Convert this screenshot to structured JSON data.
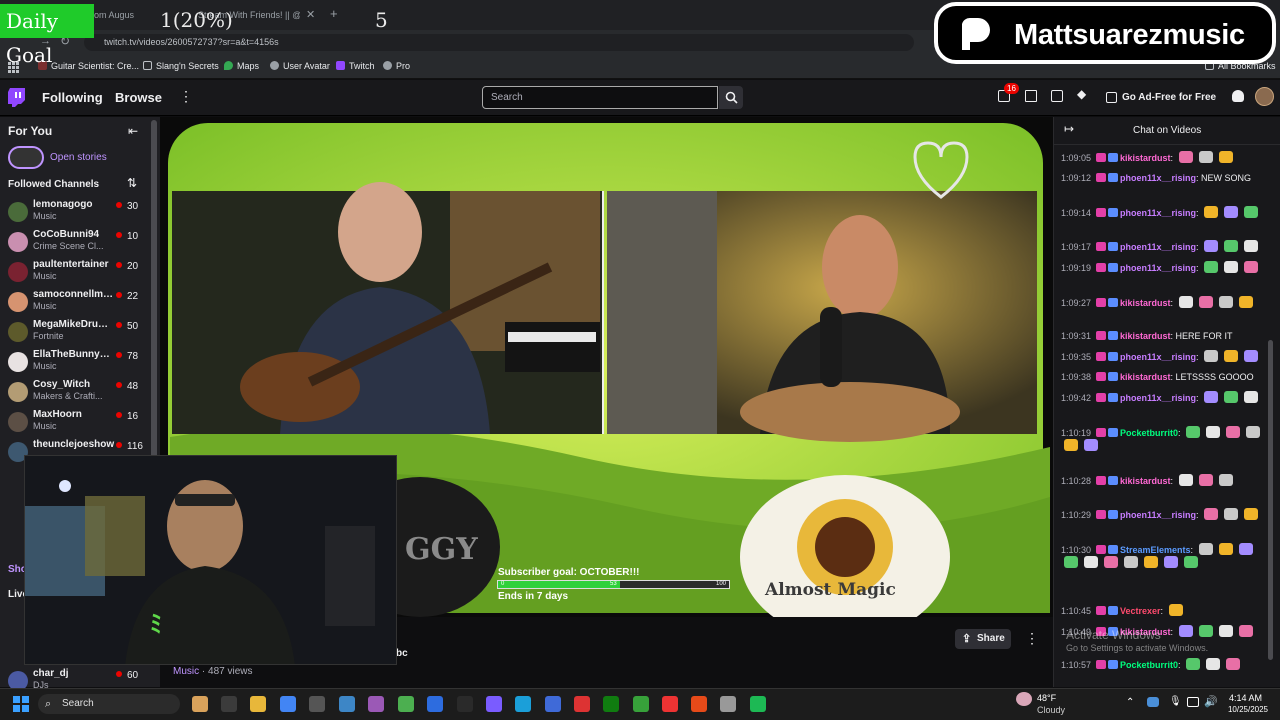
{
  "overlay": {
    "daily_goal_label": "Daily Goal",
    "goal_progress": "1(20%)",
    "goal_target": "5",
    "brand_name": "Mattsuarezmusic"
  },
  "browser": {
    "tabs": [
      {
        "label": "Live Stream from Augus"
      },
      {
        "label": "Stream With Friends! || @alm"
      }
    ],
    "url": "twitch.tv/videos/2600572737?sr=a&t=4156s",
    "bookmarks": [
      "Guitar Scientist: Cre...",
      "Slang'n Secrets",
      "Maps",
      "User Avatar",
      "Twitch",
      "Pro"
    ],
    "all_bookmarks": "All Bookmarks"
  },
  "twitch_nav": {
    "following": "Following",
    "browse": "Browse",
    "search_placeholder": "Search",
    "notifications_count": "16",
    "ad_free": "Go Ad-Free for Free"
  },
  "sidebar": {
    "for_you": "For You",
    "open_stories": "Open stories",
    "followed_channels": "Followed Channels",
    "channels": [
      {
        "name": "lemonagogo",
        "category": "Music",
        "viewers": "30",
        "color": "#4a6b3a"
      },
      {
        "name": "CoCoBunni94",
        "category": "Crime Scene Cl...",
        "viewers": "10",
        "color": "#c98fb0"
      },
      {
        "name": "paultentertainer",
        "category": "Music",
        "viewers": "20",
        "color": "#7a2231"
      },
      {
        "name": "samoconnellmu...",
        "category": "Music",
        "viewers": "22",
        "color": "#d69370"
      },
      {
        "name": "MegaMikeDrum...",
        "category": "Fortnite",
        "viewers": "50",
        "color": "#5d5a2b"
      },
      {
        "name": "EllaTheBunnyM...",
        "category": "Music",
        "viewers": "78",
        "color": "#e8e2e2"
      },
      {
        "name": "Cosy_Witch",
        "category": "Makers & Crafti...",
        "viewers": "48",
        "color": "#b39c74"
      },
      {
        "name": "MaxHoorn",
        "category": "Music",
        "viewers": "16",
        "color": "#5c4f45"
      },
      {
        "name": "theunclejoeshow",
        "category": "",
        "viewers": "116",
        "color": "#3d5870"
      }
    ],
    "show_more": "Sho",
    "live_label": "Live",
    "bottom_channel": {
      "name": "char_dj",
      "category": "DJs",
      "viewers": "60",
      "color": "#4b5aa3"
    }
  },
  "video": {
    "sub_goal_title": "Subscriber goal: OCTOBER!!!",
    "sub_goal_start": "0",
    "sub_goal_current": "53",
    "sub_goal_max": "100",
    "sub_goal_progress": 0.53,
    "ends_in": "Ends in 7 days",
    "art_text": "Almost Magic",
    "sign_letters": "GGY",
    "category_link": "Music",
    "views": "487 views",
    "title_fragment": "bc",
    "share": "Share"
  },
  "chat": {
    "title": "Chat on Videos",
    "messages": [
      {
        "time": "1:09:05",
        "user": "kikistardust",
        "color": "#ff69d4",
        "text": ""
      },
      {
        "time": "1:09:12",
        "user": "phoen11x__rising",
        "color": "#c77dff",
        "text": "NEW SONG"
      },
      {
        "time": "1:09:14",
        "user": "phoen11x__rising",
        "color": "#c77dff",
        "text": ""
      },
      {
        "time": "1:09:17",
        "user": "phoen11x__rising",
        "color": "#c77dff",
        "text": ""
      },
      {
        "time": "1:09:19",
        "user": "phoen11x__rising",
        "color": "#c77dff",
        "text": ""
      },
      {
        "time": "1:09:27",
        "user": "kikistardust",
        "color": "#ff69d4",
        "text": ""
      },
      {
        "time": "1:09:31",
        "user": "kikistardust",
        "color": "#ff69d4",
        "text": "HERE FOR IT"
      },
      {
        "time": "1:09:35",
        "user": "phoen11x__rising",
        "color": "#c77dff",
        "text": ""
      },
      {
        "time": "1:09:38",
        "user": "kikistardust",
        "color": "#ff69d4",
        "text": "LETSSSS GOOOO"
      },
      {
        "time": "1:09:42",
        "user": "phoen11x__rising",
        "color": "#c77dff",
        "text": ""
      },
      {
        "time": "1:10:19",
        "user": "Pocketburrit0",
        "color": "#00ff7f",
        "text": ""
      },
      {
        "time": "1:10:28",
        "user": "kikistardust",
        "color": "#ff69d4",
        "text": ""
      },
      {
        "time": "1:10:29",
        "user": "phoen11x__rising",
        "color": "#c77dff",
        "text": ""
      },
      {
        "time": "1:10:30",
        "user": "StreamElements",
        "color": "#5b9bff",
        "text": ""
      },
      {
        "time": "1:10:45",
        "user": "Vectrexer",
        "color": "#ff4b6e",
        "text": ""
      },
      {
        "time": "1:10:49",
        "user": "kikistardust",
        "color": "#ff69d4",
        "text": ""
      },
      {
        "time": "1:10:57",
        "user": "Pocketburrit0",
        "color": "#00ff7f",
        "text": ""
      }
    ],
    "watermark1": "Activate Windows",
    "watermark2": "Go to Settings to activate Windows."
  },
  "taskbar": {
    "search": "Search",
    "weather_temp": "48°F",
    "weather_desc": "Cloudy",
    "time": "4:14 AM",
    "date": "10/25/2025"
  }
}
